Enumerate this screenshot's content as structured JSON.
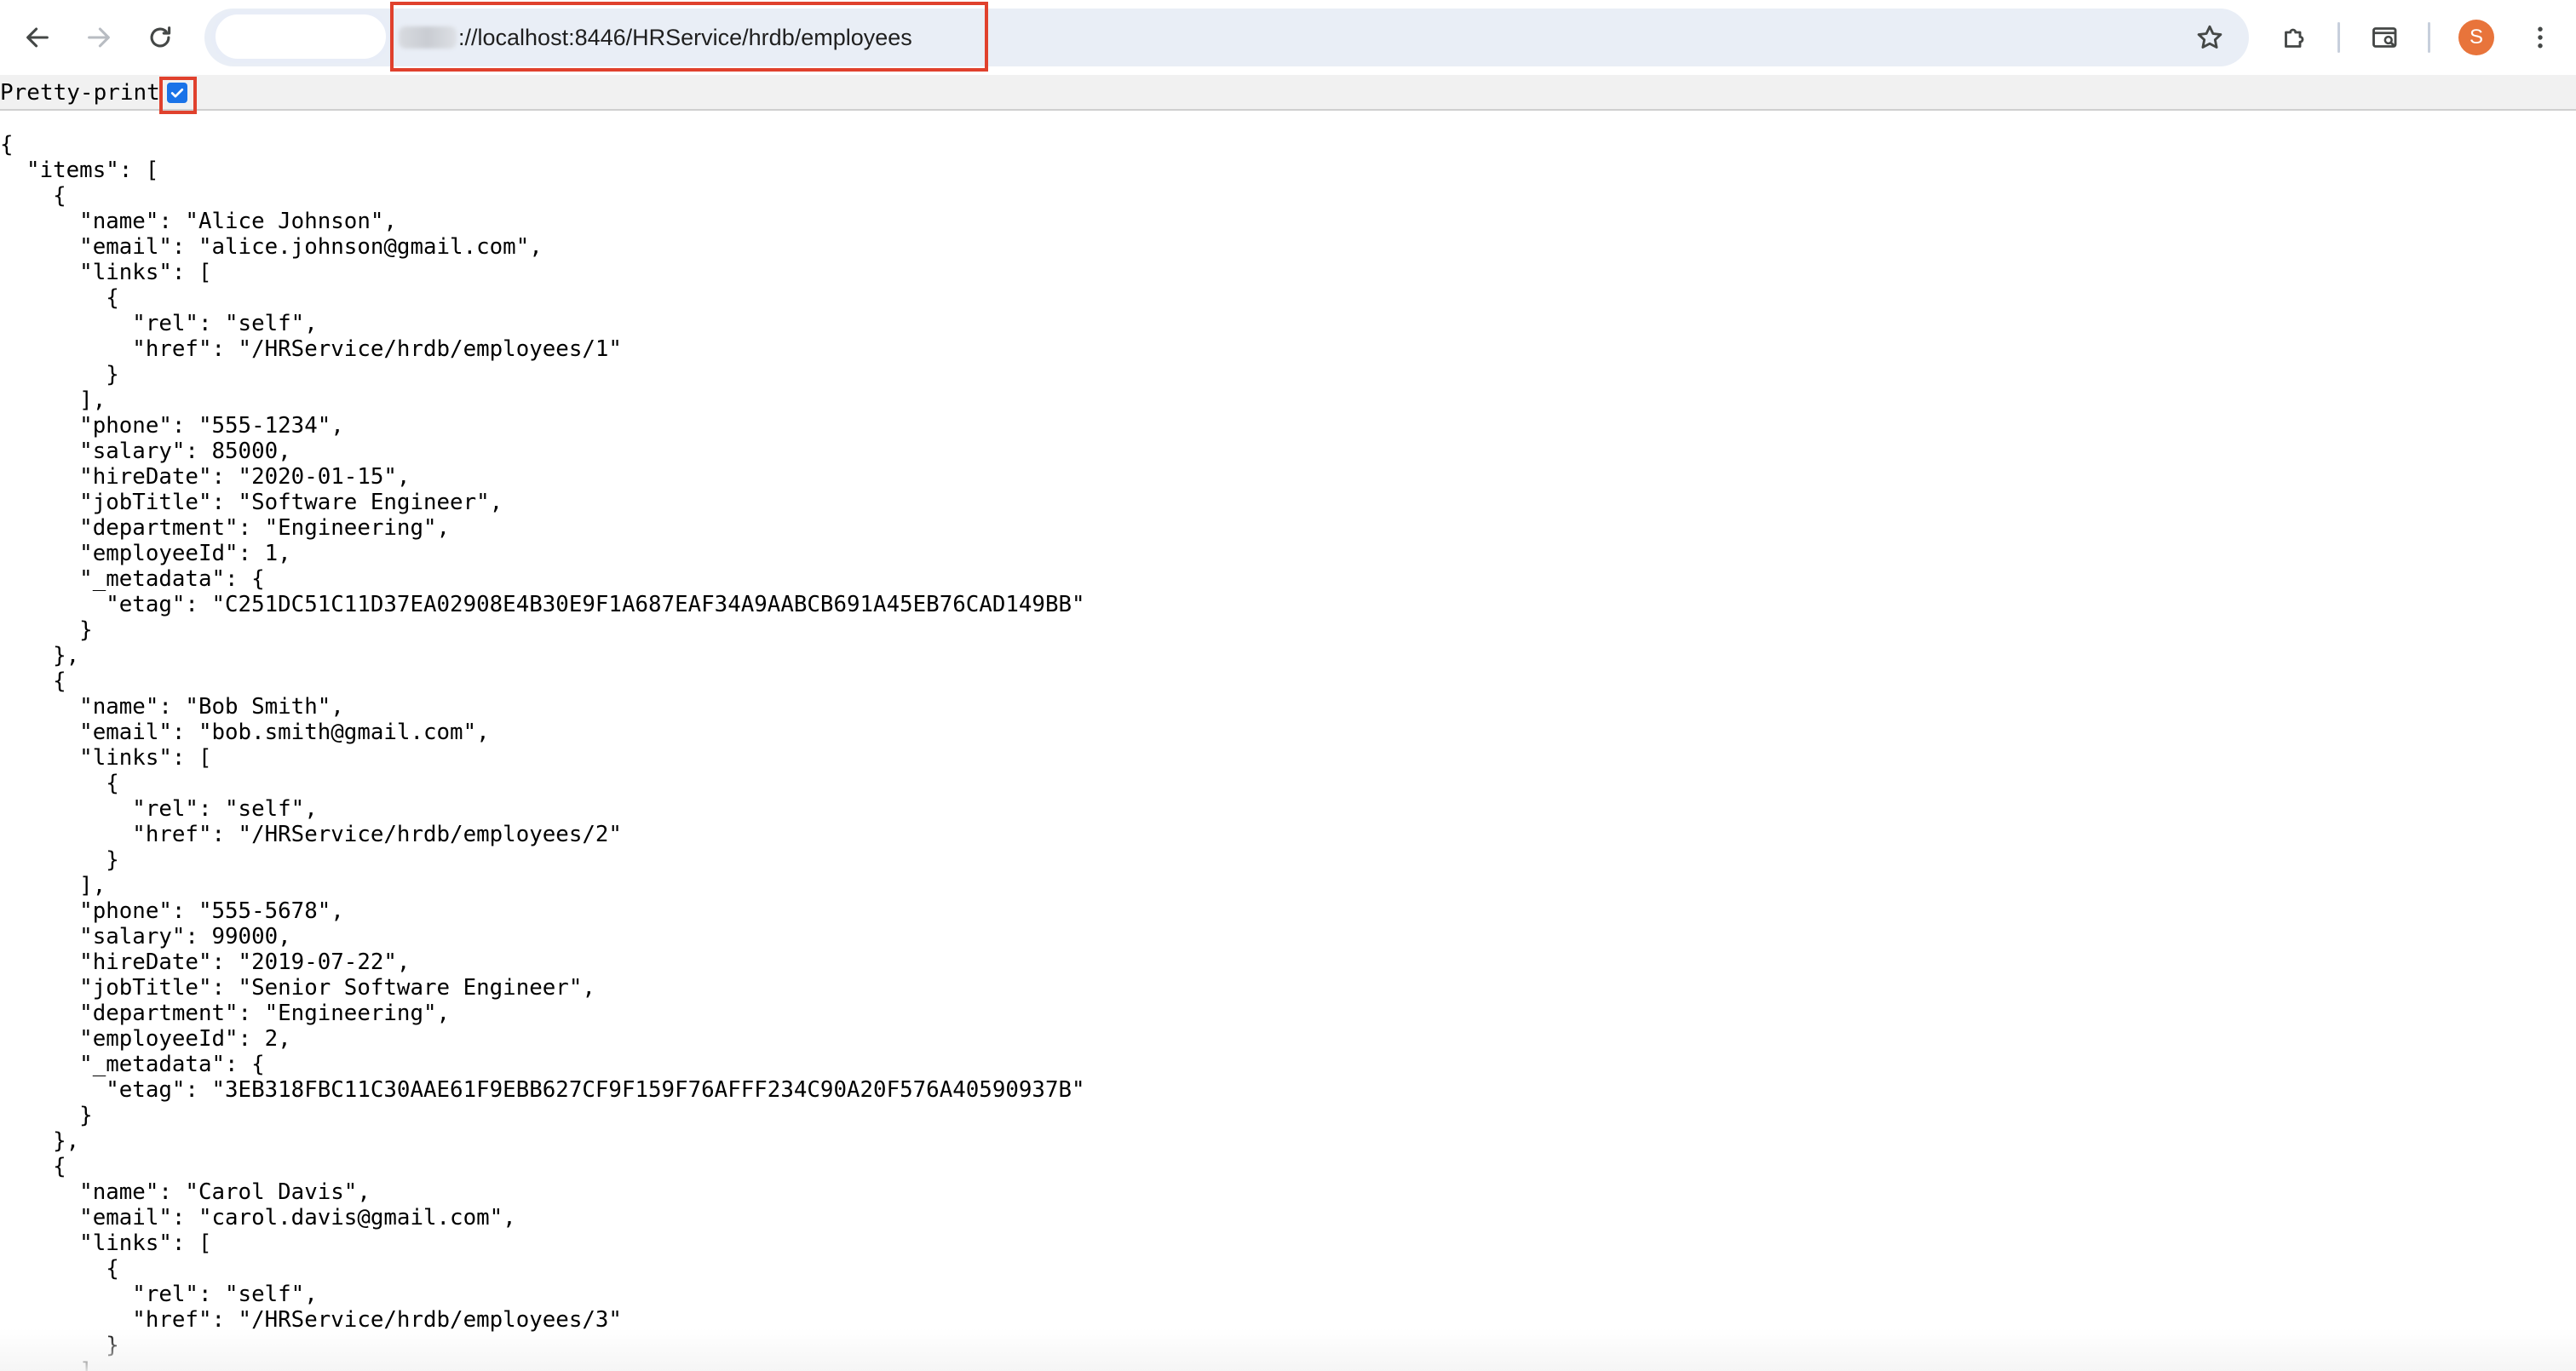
{
  "browser": {
    "url_scheme_redacted": "http",
    "url": "://localhost:8446/HRService/hrdb/employees",
    "profile_initial": "S",
    "icons": {
      "back": "back-arrow-icon",
      "forward": "forward-arrow-icon",
      "reload": "reload-icon",
      "bookmark": "star-icon",
      "extensions": "puzzle-icon",
      "tab_search": "tab-search-icon",
      "menu": "kebab-menu-icon"
    },
    "colors": {
      "omnibox_bg": "#e9eef6",
      "highlight_box": "#e0412d",
      "avatar": "#e8743b",
      "checkbox": "#1a73e8"
    }
  },
  "viewer": {
    "pretty_print_label": "Pretty-print",
    "pretty_print_checked": true
  },
  "json_lines": [
    "{",
    "  \"items\": [",
    "    {",
    "      \"name\": \"Alice Johnson\",",
    "      \"email\": \"alice.johnson@gmail.com\",",
    "      \"links\": [",
    "        {",
    "          \"rel\": \"self\",",
    "          \"href\": \"/HRService/hrdb/employees/1\"",
    "        }",
    "      ],",
    "      \"phone\": \"555-1234\",",
    "      \"salary\": 85000,",
    "      \"hireDate\": \"2020-01-15\",",
    "      \"jobTitle\": \"Software Engineer\",",
    "      \"department\": \"Engineering\",",
    "      \"employeeId\": 1,",
    "      \"_metadata\": {",
    "        \"etag\": \"C251DC51C11D37EA02908E4B30E9F1A687EAF34A9AABCB691A45EB76CAD149BB\"",
    "      }",
    "    },",
    "    {",
    "      \"name\": \"Bob Smith\",",
    "      \"email\": \"bob.smith@gmail.com\",",
    "      \"links\": [",
    "        {",
    "          \"rel\": \"self\",",
    "          \"href\": \"/HRService/hrdb/employees/2\"",
    "        }",
    "      ],",
    "      \"phone\": \"555-5678\",",
    "      \"salary\": 99000,",
    "      \"hireDate\": \"2019-07-22\",",
    "      \"jobTitle\": \"Senior Software Engineer\",",
    "      \"department\": \"Engineering\",",
    "      \"employeeId\": 2,",
    "      \"_metadata\": {",
    "        \"etag\": \"3EB318FBC11C30AAE61F9EBB627CF9F159F76AFFF234C90A20F576A40590937B\"",
    "      }",
    "    },",
    "    {",
    "      \"name\": \"Carol Davis\",",
    "      \"email\": \"carol.davis@gmail.com\",",
    "      \"links\": [",
    "        {",
    "          \"rel\": \"self\",",
    "          \"href\": \"/HRService/hrdb/employees/3\"",
    "        }",
    "      ],"
  ]
}
